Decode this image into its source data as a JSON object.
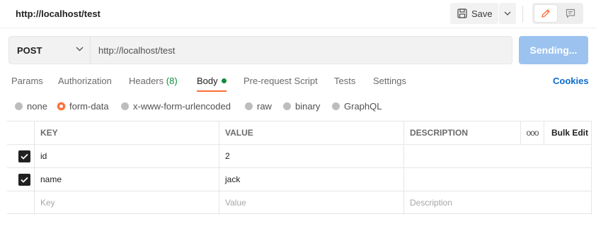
{
  "request": {
    "title": "http://localhost/test"
  },
  "toolbar": {
    "save_label": "Save",
    "save_icon": "save-icon",
    "edit_icon": "pencil-icon",
    "comment_icon": "comment-icon"
  },
  "url_bar": {
    "method": "POST",
    "url": "http://localhost/test",
    "send_label": "Sending..."
  },
  "tabs": {
    "params": "Params",
    "authorization": "Authorization",
    "headers": "Headers",
    "headers_count": "(8)",
    "body": "Body",
    "prerequest": "Pre-request Script",
    "tests": "Tests",
    "settings": "Settings",
    "cookies": "Cookies",
    "active": "Body"
  },
  "body_types": {
    "options": [
      "none",
      "form-data",
      "x-www-form-urlencoded",
      "raw",
      "binary",
      "GraphQL"
    ],
    "selected": "form-data"
  },
  "table": {
    "headers": {
      "key": "KEY",
      "value": "VALUE",
      "description": "DESCRIPTION",
      "more": "ooo",
      "bulk_edit": "Bulk Edit"
    },
    "rows": [
      {
        "checked": true,
        "key": "id",
        "value": "2",
        "description": ""
      },
      {
        "checked": true,
        "key": "name",
        "value": "jack",
        "description": ""
      }
    ],
    "placeholders": {
      "key": "Key",
      "value": "Value",
      "description": "Description"
    }
  },
  "colors": {
    "accent": "#ff6c37",
    "link": "#0b6bcb",
    "send_button": "#9cc3f0",
    "body_indicator": "#0f8c3a"
  }
}
